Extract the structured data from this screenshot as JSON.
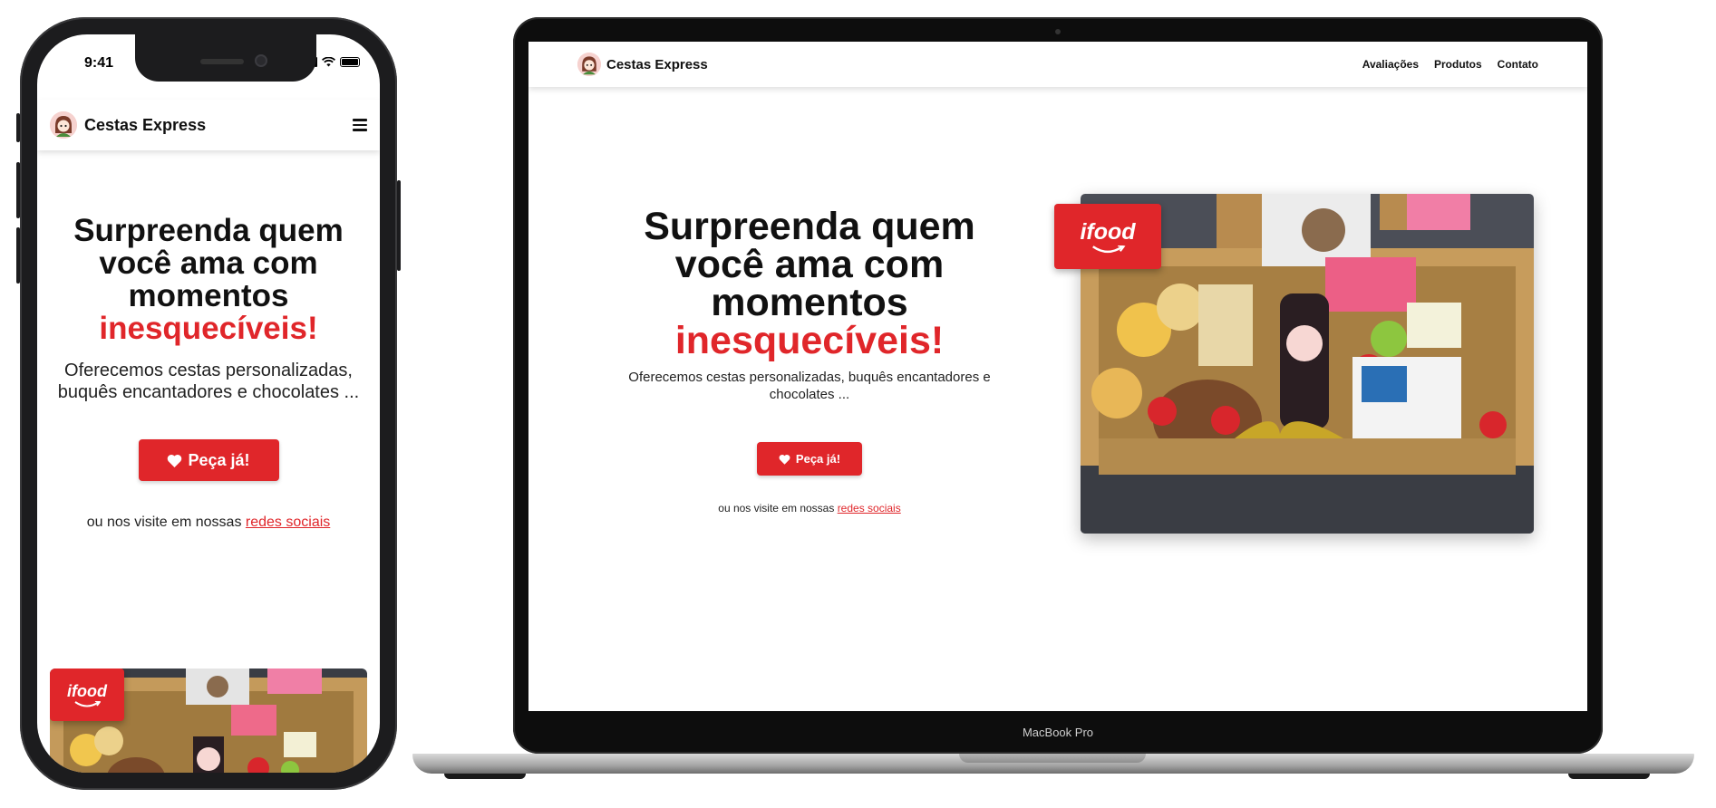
{
  "phone": {
    "status_time": "9:41",
    "brand": "Cestas Express",
    "hero": {
      "title_line1": "Surpreenda quem",
      "title_line2": "você ama com",
      "title_line3": "momentos",
      "title_accent": "inesquecíveis!",
      "subtitle": "Oferecemos cestas personalizadas, buquês encantadores e chocolates ...",
      "cta": "Peça já!",
      "social_prefix": "ou nos visite em nossas",
      "social_link": "redes sociais"
    },
    "badge": "ifood"
  },
  "laptop": {
    "brand": "Cestas Express",
    "nav": [
      "Avaliações",
      "Produtos",
      "Contato"
    ],
    "hero": {
      "title_line1": "Surpreenda quem",
      "title_line2": "você ama com",
      "title_line3": "momentos",
      "title_accent": "inesquecíveis!",
      "subtitle": "Oferecemos cestas personalizadas, buquês encantadores e chocolates ...",
      "cta": "Peça já!",
      "social_prefix": "ou nos visite em nossas",
      "social_link": "redes sociais"
    },
    "badge": "ifood",
    "device_label": "MacBook Pro"
  },
  "colors": {
    "accent": "#e0262a",
    "text": "#111111",
    "device_frame": "#1c1c1e"
  },
  "icons": [
    "logo-avatar-icon",
    "hamburger-menu-icon",
    "heart-icon",
    "signal-icon",
    "wifi-icon",
    "battery-icon",
    "ifood-logo"
  ]
}
